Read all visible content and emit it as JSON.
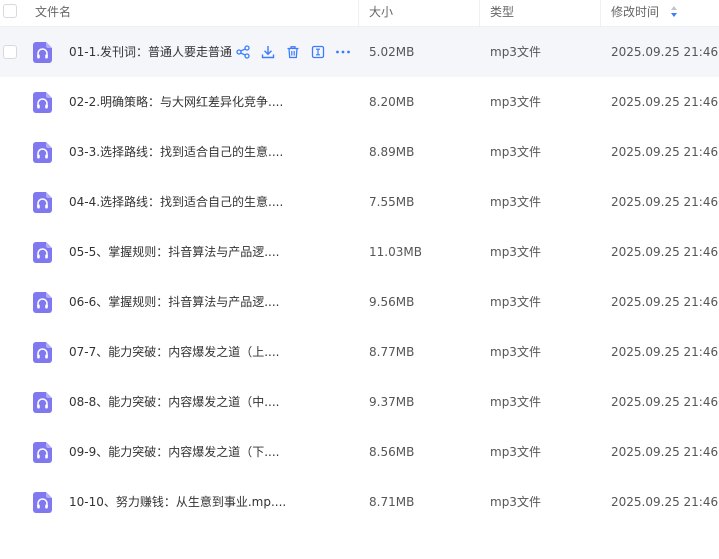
{
  "header": {
    "name": "文件名",
    "size": "大小",
    "type": "类型",
    "time": "修改时间"
  },
  "colors": {
    "accent": "#3b7cff",
    "file_icon": "#7f78ef",
    "hover_row": "#f5f6fa"
  },
  "icons": {
    "file": "headphones-icon",
    "share": "share-icon",
    "download": "download-icon",
    "delete": "trash-icon",
    "rename": "rename-icon",
    "more": "more-icon"
  },
  "files": [
    {
      "name": "01-1.发刊词：普通人要走普通",
      "size": "5.02MB",
      "type": "mp3文件",
      "time": "2025.09.25 21:46"
    },
    {
      "name": "02-2.明确策略：与大网红差异化竞争....",
      "size": "8.20MB",
      "type": "mp3文件",
      "time": "2025.09.25 21:46"
    },
    {
      "name": "03-3.选择路线：找到适合自己的生意....",
      "size": "8.89MB",
      "type": "mp3文件",
      "time": "2025.09.25 21:46"
    },
    {
      "name": "04-4.选择路线：找到适合自己的生意....",
      "size": "7.55MB",
      "type": "mp3文件",
      "time": "2025.09.25 21:46"
    },
    {
      "name": "05-5、掌握规则：抖音算法与产品逻....",
      "size": "11.03MB",
      "type": "mp3文件",
      "time": "2025.09.25 21:46"
    },
    {
      "name": "06-6、掌握规则：抖音算法与产品逻....",
      "size": "9.56MB",
      "type": "mp3文件",
      "time": "2025.09.25 21:46"
    },
    {
      "name": "07-7、能力突破：内容爆发之道（上....",
      "size": "8.77MB",
      "type": "mp3文件",
      "time": "2025.09.25 21:46"
    },
    {
      "name": "08-8、能力突破：内容爆发之道（中....",
      "size": "9.37MB",
      "type": "mp3文件",
      "time": "2025.09.25 21:46"
    },
    {
      "name": "09-9、能力突破：内容爆发之道（下....",
      "size": "8.56MB",
      "type": "mp3文件",
      "time": "2025.09.25 21:46"
    },
    {
      "name": "10-10、努力赚钱：从生意到事业.mp....",
      "size": "8.71MB",
      "type": "mp3文件",
      "time": "2025.09.25 21:46"
    }
  ]
}
